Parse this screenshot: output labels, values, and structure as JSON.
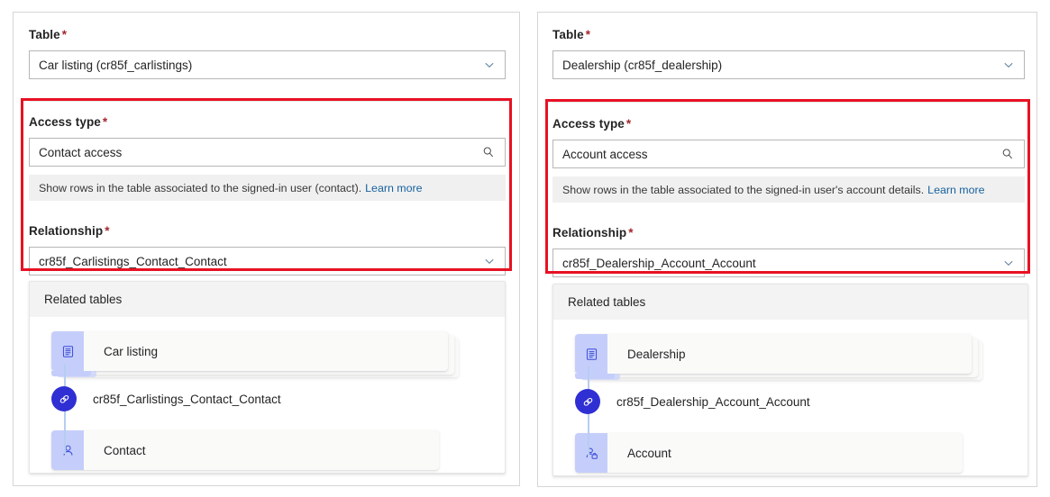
{
  "panels": [
    {
      "name": "car-listing-panel",
      "table": {
        "label": "Table",
        "required_mark": "*",
        "value": "Car listing (cr85f_carlistings)",
        "icon": "chevron-down-icon"
      },
      "access_type": {
        "label": "Access type",
        "required_mark": "*",
        "value": "Contact access",
        "icon": "search-icon",
        "description": "Show rows in the table associated to the signed-in user (contact).",
        "link_text": "Learn more"
      },
      "relationship": {
        "label": "Relationship",
        "required_mark": "*",
        "value": "cr85f_Carlistings_Contact_Contact",
        "icon": "chevron-down-icon"
      },
      "related_tables": {
        "title": "Related tables",
        "source_node": {
          "label": "Car listing",
          "icon": "table-icon"
        },
        "relationship_node": {
          "label": "cr85f_Carlistings_Contact_Contact",
          "icon": "link-icon"
        },
        "target_node": {
          "label": "Contact",
          "icon": "person-icon"
        }
      }
    },
    {
      "name": "dealership-panel",
      "table": {
        "label": "Table",
        "required_mark": "*",
        "value": "Dealership (cr85f_dealership)",
        "icon": "chevron-down-icon"
      },
      "access_type": {
        "label": "Access type",
        "required_mark": "*",
        "value": "Account access",
        "icon": "search-icon",
        "description": "Show rows in the table associated to the signed-in user's account details.",
        "link_text": "Learn more"
      },
      "relationship": {
        "label": "Relationship",
        "required_mark": "*",
        "value": "cr85f_Dealership_Account_Account",
        "icon": "chevron-down-icon"
      },
      "related_tables": {
        "title": "Related tables",
        "source_node": {
          "label": "Dealership",
          "icon": "table-icon"
        },
        "relationship_node": {
          "label": "cr85f_Dealership_Account_Account",
          "icon": "link-icon"
        },
        "target_node": {
          "label": "Account",
          "icon": "account-person-icon"
        }
      }
    }
  ],
  "colors": {
    "highlight": "#e81123",
    "link": "#17629e",
    "required": "#a4262c",
    "node_icon_bg": "#c5cefa",
    "node_icon_fg": "#3a4ad9",
    "relationship_dot": "#2f2fd4",
    "connector": "#b7cdf0",
    "info_bar_bg": "#f0f0f0",
    "card_header_bg": "#f3f3f3"
  }
}
